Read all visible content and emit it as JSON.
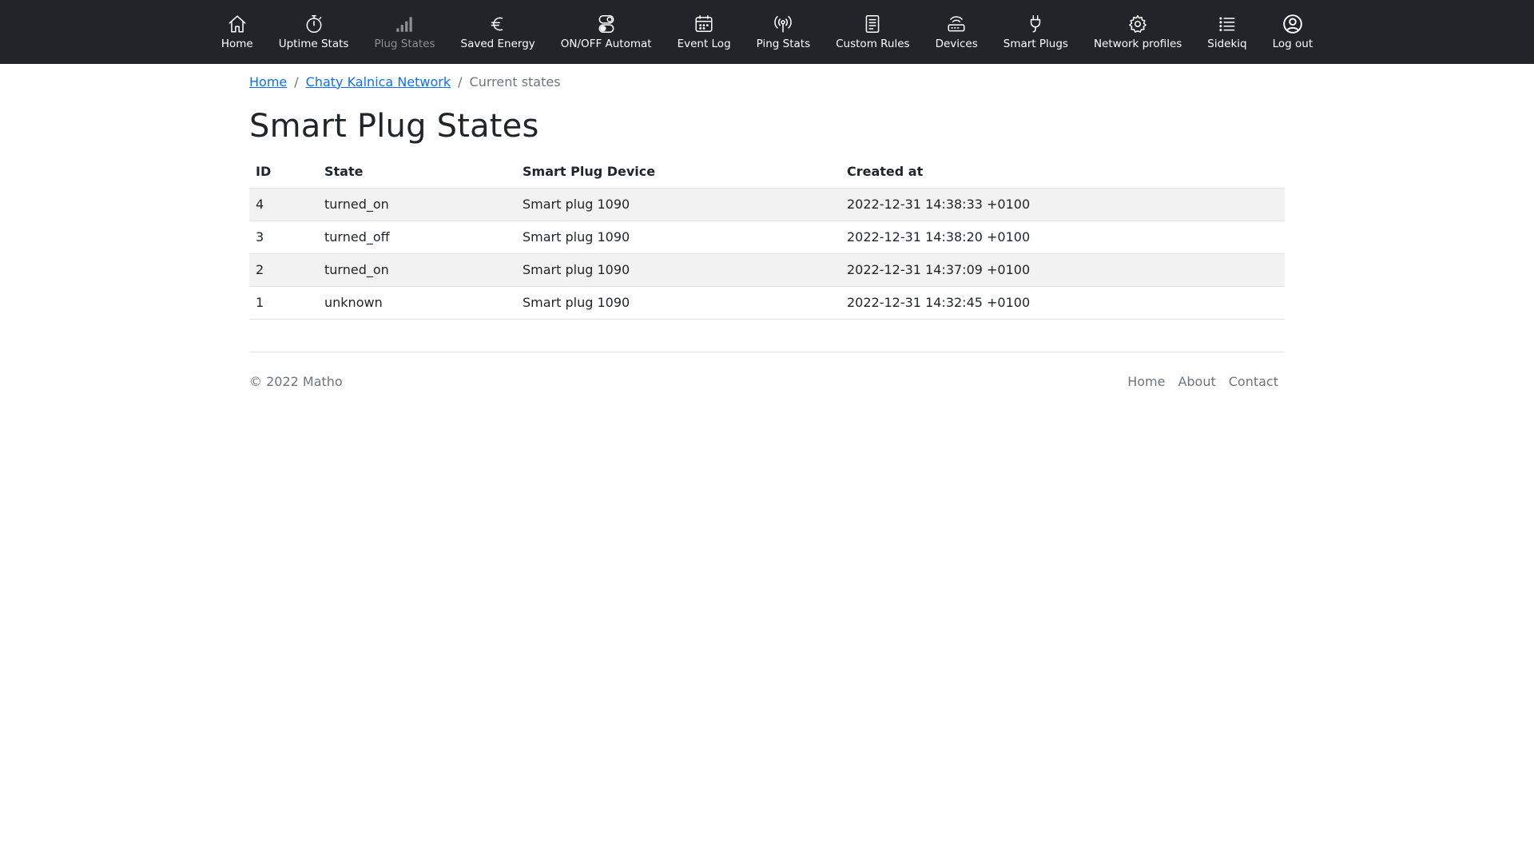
{
  "nav": {
    "items": [
      {
        "label": "Home",
        "icon": "house-icon",
        "active": true
      },
      {
        "label": "Uptime Stats",
        "icon": "stopwatch-icon",
        "active": true
      },
      {
        "label": "Plug States",
        "icon": "signal-bars-icon",
        "active": false
      },
      {
        "label": "Saved Energy",
        "icon": "euro-icon",
        "active": true
      },
      {
        "label": "ON/OFF Automat",
        "icon": "toggles-icon",
        "active": true
      },
      {
        "label": "Event Log",
        "icon": "calendar-icon",
        "active": true
      },
      {
        "label": "Ping Stats",
        "icon": "broadcast-icon",
        "active": true
      },
      {
        "label": "Custom Rules",
        "icon": "document-icon",
        "active": true
      },
      {
        "label": "Devices",
        "icon": "router-icon",
        "active": true
      },
      {
        "label": "Smart Plugs",
        "icon": "plug-icon",
        "active": true
      },
      {
        "label": "Network profiles",
        "icon": "gear-icon",
        "active": true
      },
      {
        "label": "Sidekiq",
        "icon": "list-icon",
        "active": true
      },
      {
        "label": "Log out",
        "icon": "user-circle-icon",
        "active": true
      }
    ]
  },
  "breadcrumb": {
    "home": "Home",
    "network": "Chaty Kalnica Network",
    "separator": "/",
    "current": "Current states"
  },
  "page": {
    "title": "Smart Plug States"
  },
  "table": {
    "headers": {
      "id": "ID",
      "state": "State",
      "device": "Smart Plug Device",
      "created": "Created at"
    },
    "rows": [
      {
        "id": "4",
        "state": "turned_on",
        "device": "Smart plug 1090",
        "created": "2022-12-31 14:38:33 +0100"
      },
      {
        "id": "3",
        "state": "turned_off",
        "device": "Smart plug 1090",
        "created": "2022-12-31 14:38:20 +0100"
      },
      {
        "id": "2",
        "state": "turned_on",
        "device": "Smart plug 1090",
        "created": "2022-12-31 14:37:09 +0100"
      },
      {
        "id": "1",
        "state": "unknown",
        "device": "Smart plug 1090",
        "created": "2022-12-31 14:32:45 +0100"
      }
    ]
  },
  "footer": {
    "copyright": "© 2022 Matho",
    "links": {
      "home": "Home",
      "about": "About",
      "contact": "Contact"
    }
  },
  "colors": {
    "navbar_bg": "#212529",
    "link": "#0d6efd",
    "muted": "#6c757d",
    "stripe": "#f2f2f2"
  }
}
